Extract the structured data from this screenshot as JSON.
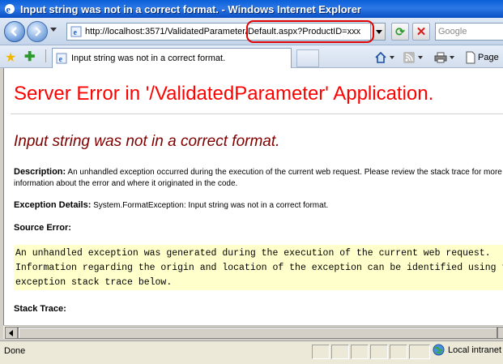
{
  "window": {
    "title": "Input string was not in a correct format. - Windows Internet Explorer"
  },
  "address_bar": {
    "url": "http://localhost:3571/ValidatedParameter/Default.aspx?ProductID=xxx",
    "search_placeholder": "Google"
  },
  "tabs": [
    {
      "label": "Input string was not in a correct format."
    }
  ],
  "command_bar": {
    "page_label": "Page"
  },
  "page": {
    "title": "Server Error in '/ValidatedParameter' Application.",
    "error_message": "Input string was not in a correct format.",
    "description_label": "Description:",
    "description_text": "An unhandled exception occurred during the execution of the current web request. Please review the stack trace for more information about the error and where it originated in the code.",
    "exception_label": "Exception Details:",
    "exception_text": "System.FormatException: Input string was not in a correct format.",
    "source_error_heading": "Source Error:",
    "source_error_code": [
      "An unhandled exception was generated during the execution of the current web request.",
      "Information regarding the origin and location of the exception can be identified using the",
      "exception stack trace below."
    ],
    "stack_trace_heading": "Stack Trace:"
  },
  "status_bar": {
    "status": "Done",
    "zone": "Local intranet"
  },
  "colors": {
    "title_red": "#ff0000",
    "message_maroon": "#800000",
    "code_background": "#ffffcc",
    "highlight_red": "#e00000"
  }
}
